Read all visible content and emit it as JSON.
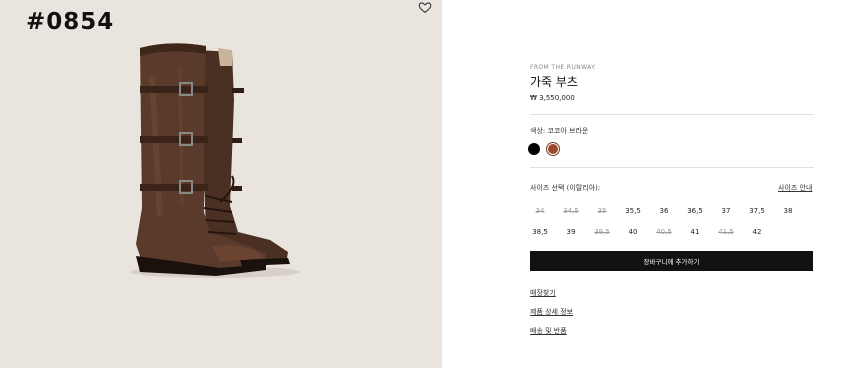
{
  "lot_tag": "#0854",
  "product": {
    "eyebrow": "FROM THE RUNWAY",
    "title": "가죽 부츠",
    "price": "₩ 3,550,000",
    "color_label": "색상: 코코아 브라운",
    "swatches": [
      {
        "name": "black",
        "color": "#000000"
      },
      {
        "name": "cocoa-brown",
        "color": "#9b4a2b",
        "selected": true
      }
    ]
  },
  "sizes": {
    "label": "사이즈 선택 (이탈리아):",
    "guide_link": "사이즈 안내",
    "items": [
      {
        "label": "34",
        "available": false
      },
      {
        "label": "34,5",
        "available": false
      },
      {
        "label": "35",
        "available": false
      },
      {
        "label": "35,5",
        "available": true
      },
      {
        "label": "36",
        "available": true
      },
      {
        "label": "36,5",
        "available": true
      },
      {
        "label": "37",
        "available": true
      },
      {
        "label": "37,5",
        "available": true
      },
      {
        "label": "38",
        "available": true
      },
      {
        "label": "38,5",
        "available": true
      },
      {
        "label": "39",
        "available": true
      },
      {
        "label": "39,5",
        "available": false
      },
      {
        "label": "40",
        "available": true
      },
      {
        "label": "40,5",
        "available": false
      },
      {
        "label": "41",
        "available": true
      },
      {
        "label": "41,5",
        "available": false
      },
      {
        "label": "42",
        "available": true
      }
    ]
  },
  "actions": {
    "add_to_cart": "장바구니에 추가하기"
  },
  "links": {
    "store_finder": "매장찾기",
    "details": "제품 상세 정보",
    "shipping": "배송 및 반품"
  },
  "icons": {
    "wishlist": "heart-icon"
  }
}
